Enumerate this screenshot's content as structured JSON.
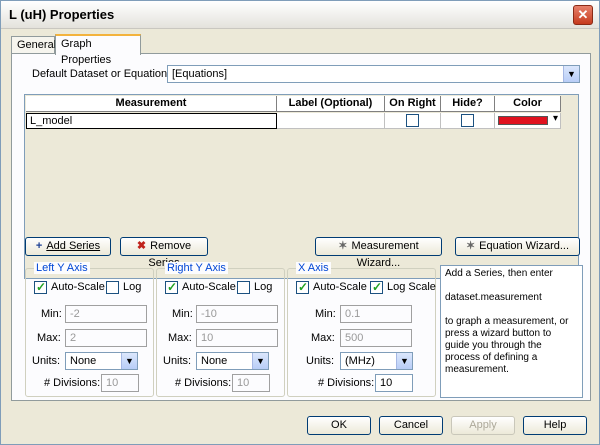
{
  "window": {
    "title": "L (uH) Properties",
    "close_glyph": "✕"
  },
  "tabs": [
    {
      "label": "General"
    },
    {
      "label": "Graph Properties"
    }
  ],
  "default_dataset": {
    "label": "Default Dataset or Equations:",
    "value": "[Equations]"
  },
  "grid": {
    "columns": [
      "Measurement",
      "Label (Optional)",
      "On Right",
      "Hide?",
      "Color"
    ],
    "rows": [
      {
        "measurement": "L_model",
        "label": "",
        "on_right": false,
        "hide": false,
        "color": "#e0121f"
      }
    ]
  },
  "buttons": {
    "add_series": "Add Series",
    "remove_series": "Remove Series",
    "measurement_wizard": "Measurement Wizard...",
    "equation_wizard": "Equation Wizard...",
    "ok": "OK",
    "cancel": "Cancel",
    "apply": "Apply",
    "help": "Help"
  },
  "icons": {
    "add": "+",
    "remove": "✖",
    "wand": "✶",
    "dropdown": "▾",
    "combo_arrow": "▼"
  },
  "left_y": {
    "title": "Left Y Axis",
    "autoscale_label": "Auto-Scale",
    "autoscale": true,
    "log_label": "Log",
    "log": false,
    "min_label": "Min:",
    "min": "-2",
    "max_label": "Max:",
    "max": "2",
    "units_label": "Units:",
    "units": "None",
    "divisions_label": "# Divisions:",
    "divisions": "10"
  },
  "right_y": {
    "title": "Right Y Axis",
    "autoscale_label": "Auto-Scale",
    "autoscale": true,
    "log_label": "Log",
    "log": false,
    "min_label": "Min:",
    "min": "-10",
    "max_label": "Max:",
    "max": "10",
    "units_label": "Units:",
    "units": "None",
    "divisions_label": "# Divisions:",
    "divisions": "10"
  },
  "x_axis": {
    "title": "X Axis",
    "autoscale_label": "Auto-Scale",
    "autoscale": true,
    "log_label": "Log Scale",
    "log": true,
    "min_label": "Min:",
    "min": "0.1",
    "max_label": "Max:",
    "max": "500",
    "units_label": "Units:",
    "units": "(MHz)",
    "divisions_label": "# Divisions:",
    "divisions": "10"
  },
  "help_text": {
    "line1": "Add a Series, then enter",
    "line2": "dataset.measurement",
    "line3": "to graph a measurement, or press a wizard button to guide you through the process of defining a measurement."
  }
}
